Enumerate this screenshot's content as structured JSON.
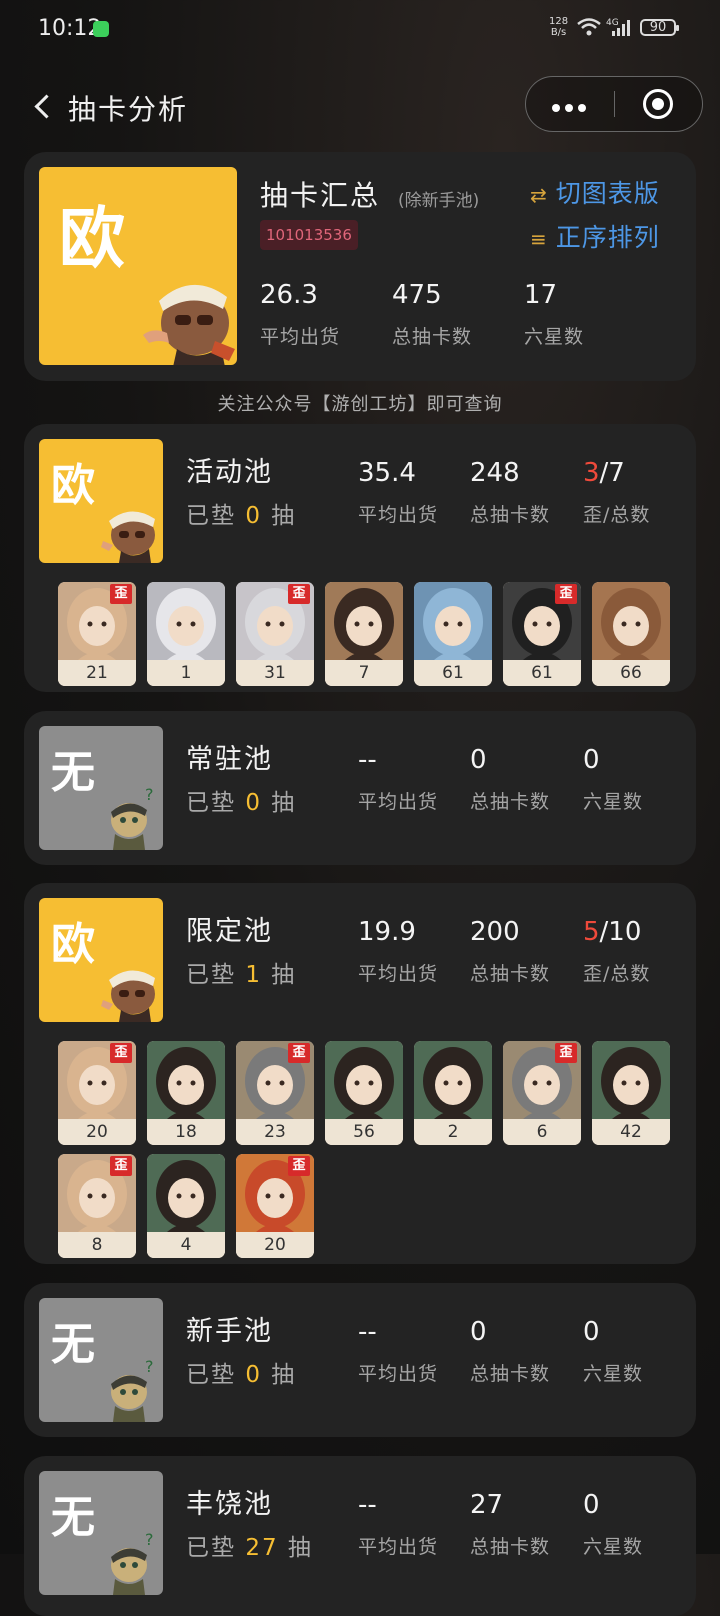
{
  "status_bar": {
    "time": "10:12",
    "net_speed_value": "128",
    "net_speed_unit": "B/s",
    "network_type": "4G",
    "battery": "90"
  },
  "nav": {
    "title": "抽卡分析",
    "back_icon": "chevron-left-icon",
    "more_icon": "more-dots-icon",
    "close_icon": "circle-target-icon"
  },
  "summary": {
    "tier": "欧",
    "title": "抽卡汇总",
    "note": "(除新手池)",
    "uid": "101013536",
    "switch_label": "切图表版",
    "sort_label": "正序排列",
    "stats": [
      {
        "value": "26.3",
        "label": "平均出货"
      },
      {
        "value": "475",
        "label": "总抽卡数"
      },
      {
        "value": "17",
        "label": "六星数"
      }
    ]
  },
  "follow_tip": "关注公众号【游创工坊】即可查询",
  "off_tag": "歪",
  "pity_prefix": "已垫",
  "pity_suffix": "抽",
  "pools": [
    {
      "name": "活动池",
      "tier": "欧",
      "pity": "0",
      "avg": "35.4",
      "avg_label": "平均出货",
      "total": "248",
      "total_label": "总抽卡数",
      "third_red": "3",
      "third_rest": "/7",
      "third_label": "歪/总数",
      "chars": [
        {
          "pulls": "21",
          "off": true,
          "hair": "#d9b48f",
          "bg": "#c9a98a"
        },
        {
          "pulls": "1",
          "off": false,
          "hair": "#e6e6ea",
          "bg": "#b9b9bf"
        },
        {
          "pulls": "31",
          "off": true,
          "hair": "#d8d8dc",
          "bg": "#c7c4c9"
        },
        {
          "pulls": "7",
          "off": false,
          "hair": "#3a2a22",
          "bg": "#a07a58"
        },
        {
          "pulls": "61",
          "off": false,
          "hair": "#8fb6d6",
          "bg": "#6e93b3"
        },
        {
          "pulls": "61",
          "off": true,
          "hair": "#202020",
          "bg": "#3e3e3e"
        },
        {
          "pulls": "66",
          "off": false,
          "hair": "#8a5a3a",
          "bg": "#a57550"
        }
      ]
    },
    {
      "name": "常驻池",
      "tier": "无",
      "pity": "0",
      "avg": "--",
      "avg_label": "平均出货",
      "total": "0",
      "total_label": "总抽卡数",
      "third_red": "",
      "third_rest": "0",
      "third_label": "六星数",
      "chars": []
    },
    {
      "name": "限定池",
      "tier": "欧",
      "pity": "1",
      "avg": "19.9",
      "avg_label": "平均出货",
      "total": "200",
      "total_label": "总抽卡数",
      "third_red": "5",
      "third_rest": "/10",
      "third_label": "歪/总数",
      "chars": [
        {
          "pulls": "20",
          "off": true,
          "hair": "#d9b48f",
          "bg": "#c9a98a"
        },
        {
          "pulls": "18",
          "off": false,
          "hair": "#2c2420",
          "bg": "#4f6b55"
        },
        {
          "pulls": "23",
          "off": true,
          "hair": "#7a7a7a",
          "bg": "#9a8a72"
        },
        {
          "pulls": "56",
          "off": false,
          "hair": "#2c2420",
          "bg": "#4f6b55"
        },
        {
          "pulls": "2",
          "off": false,
          "hair": "#2c2420",
          "bg": "#4f6b55"
        },
        {
          "pulls": "6",
          "off": true,
          "hair": "#7a7a7a",
          "bg": "#9a8a72"
        },
        {
          "pulls": "42",
          "off": false,
          "hair": "#2c2420",
          "bg": "#4f6b55"
        },
        {
          "pulls": "8",
          "off": true,
          "hair": "#d9b48f",
          "bg": "#c9a98a"
        },
        {
          "pulls": "4",
          "off": false,
          "hair": "#2c2420",
          "bg": "#4f6b55"
        },
        {
          "pulls": "20",
          "off": true,
          "hair": "#c84a2a",
          "bg": "#d07838"
        }
      ]
    },
    {
      "name": "新手池",
      "tier": "无",
      "pity": "0",
      "avg": "--",
      "avg_label": "平均出货",
      "total": "0",
      "total_label": "总抽卡数",
      "third_red": "",
      "third_rest": "0",
      "third_label": "六星数",
      "chars": []
    },
    {
      "name": "丰饶池",
      "tier": "无",
      "pity": "27",
      "avg": "--",
      "avg_label": "平均出货",
      "total": "27",
      "total_label": "总抽卡数",
      "third_red": "",
      "third_rest": "0",
      "third_label": "六星数",
      "chars": []
    }
  ],
  "colors": {
    "gold": "#f6be33",
    "accent_blue": "#4d97e6",
    "red": "#ef4a3b",
    "grey_tier": "#8d8d8d"
  }
}
